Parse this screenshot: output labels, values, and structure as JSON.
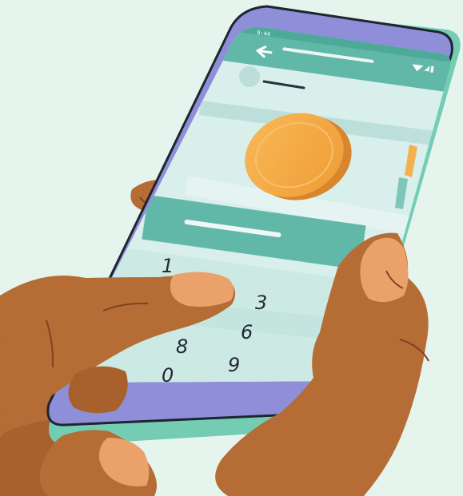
{
  "phone": {
    "status_time": "9:44",
    "keypad": {
      "visible_digits": [
        "1",
        "3",
        "6",
        "8",
        "9",
        "0"
      ],
      "backspace_icon": "backspace-icon"
    }
  },
  "colors": {
    "background": "#e6f4ee",
    "phone_frame": "#8f8ed8",
    "screen": "#d8efeb",
    "teal_bar": "#61b8a9",
    "coin": "#f4a340",
    "skin": "#b56d35"
  }
}
